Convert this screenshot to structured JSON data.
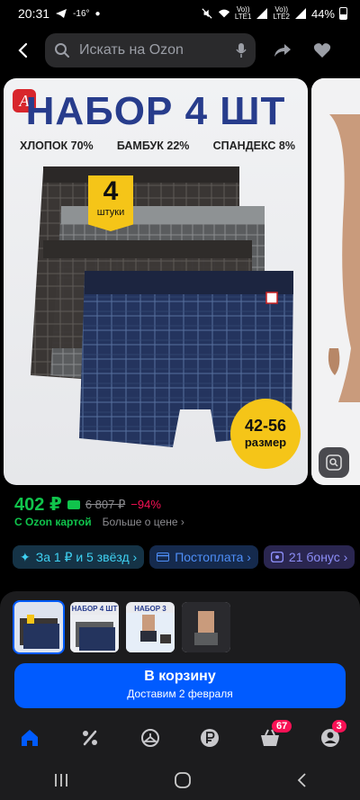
{
  "status": {
    "time": "20:31",
    "temp": "-16°",
    "network1": "LTE1",
    "network2": "LTE2",
    "vo1": "Vo))",
    "vo2": "Vo))",
    "battery": "44%"
  },
  "header": {
    "search_placeholder": "Искать на Ozon"
  },
  "product_image": {
    "title": "НАБОР 4 ШТ",
    "composition": [
      "ХЛОПОК 70%",
      "БАМБУК 22%",
      "СПАНДЕКС 8%"
    ],
    "badge_number": "4",
    "badge_text": "штуки",
    "size_range": "42-56",
    "size_label": "размер",
    "thumb_title": "НАБОР 4 ШТ",
    "thumb3_title": "НАБОР 3"
  },
  "price": {
    "current": "402 ₽",
    "old": "6 807 ₽",
    "discount": "−94%",
    "with_card": "С Ozon картой",
    "more": "Больше о цене ›"
  },
  "chips": [
    {
      "label": "За 1 ₽ и 5 звёзд ›"
    },
    {
      "label": "Постоплата ›"
    },
    {
      "label": "21 бонус ›"
    }
  ],
  "cart": {
    "title": "В корзину",
    "subtitle": "Доставим 2 февраля"
  },
  "tabbar": {
    "cart_badge": "67",
    "profile_badge": "3"
  },
  "colors": {
    "accent": "#005bff",
    "price_green": "#10c44c",
    "discount_pink": "#f91155"
  }
}
